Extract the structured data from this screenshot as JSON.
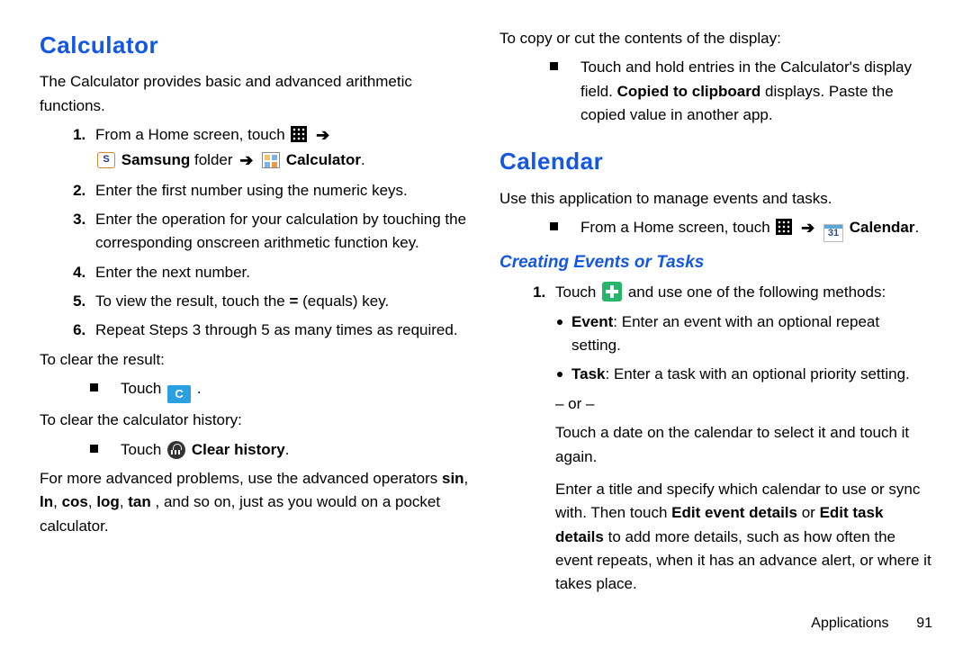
{
  "footer": {
    "section": "Applications",
    "page": "91"
  },
  "calculator": {
    "title": "Calculator",
    "lead": "The Calculator provides basic and advanced arithmetic functions.",
    "step_prefix": "From a Home screen, touch ",
    "arrow": "➔",
    "samsung_folder": "Samsung",
    "folder_word": " folder ",
    "calculator_label": "Calculator",
    "period": ".",
    "step2": "Enter the first number using the numeric keys.",
    "step3": "Enter the operation for your calculation by touching the corresponding onscreen arithmetic function key.",
    "step4": "Enter the next number.",
    "step5_a": "To view the result, touch the ",
    "step5_eq": "=",
    "step5_b": " (equals) key.",
    "step6": "Repeat Steps 3 through 5 as many times as required.",
    "clear_result_intro": "To clear the result:",
    "touch_word": "Touch ",
    "clear_C": "C",
    "clear_history_intro": "To clear the calculator history:",
    "clear_history_label": "Clear history",
    "adv_a": "For more advanced problems, use the advanced operators ",
    "adv_ops_sin": "sin",
    "adv_ops_ln": "ln",
    "adv_ops_cos": "cos",
    "adv_ops_log": "log",
    "adv_ops_tan": "tan",
    "comma": ", ",
    "adv_b": ", and so on, just as you would on a pocket calculator.",
    "copy_intro": "To copy or cut the contents of the display:",
    "copy_line": "Touch and hold entries in the Calculator's display field. ",
    "copied_label": "Copied to clipboard",
    "copy_tail": " displays. Paste the copied value in another app."
  },
  "calendar": {
    "title": "Calendar",
    "lead": "Use this application to manage events and tasks.",
    "from_home": "From a Home screen, touch ",
    "calendar_label": "Calendar",
    "cal_day": "31",
    "sub_title": "Creating Events or Tasks",
    "touch_word": "Touch ",
    "plus_tail": " and use one of the following methods:",
    "event_label": "Event",
    "event_desc": ": Enter an event with an optional repeat setting.",
    "task_label": "Task",
    "task_desc": ": Enter a task with an optional priority setting.",
    "or": "– or –",
    "touch_date": "Touch a date on the calendar to select it and touch it again.",
    "enter_a": "Enter a title and specify which calendar to use or sync with. Then touch ",
    "edit_event": "Edit event details",
    "or_word": " or ",
    "edit_task": "Edit task details",
    "enter_b": " to add more details, such as how often the event repeats, when it has an advance alert, or where it takes place."
  }
}
